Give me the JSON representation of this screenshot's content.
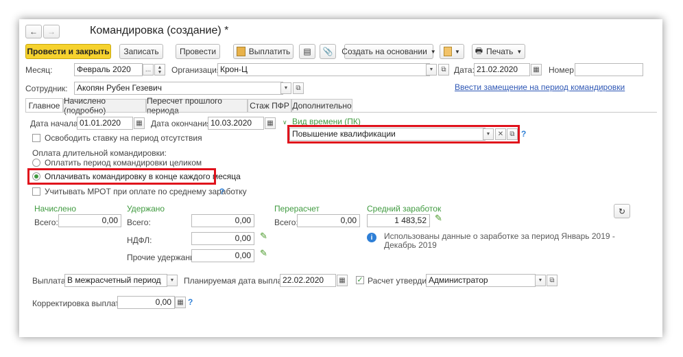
{
  "window": {
    "title": "Командировка (создание) *"
  },
  "toolbar": {
    "post_close": "Провести и закрыть",
    "save": "Записать",
    "post": "Провести",
    "pay": "Выплатить",
    "create_based": "Создать на основании",
    "print": "Печать"
  },
  "header": {
    "month_label": "Месяц:",
    "month_value": "Февраль 2020",
    "org_label": "Организация:",
    "org_value": "Крон-Ц",
    "date_label": "Дата:",
    "date_value": "21.02.2020",
    "number_label": "Номер:",
    "number_value": "",
    "employee_label": "Сотрудник:",
    "employee_value": "Акопян Рубен Гезевич",
    "replacement_link": "Ввести замещение на период командировки"
  },
  "tabs": [
    {
      "label": "Главное",
      "active": true
    },
    {
      "label": "Начислено (подробно)"
    },
    {
      "label": "Пересчет прошлого периода"
    },
    {
      "label": "Стаж ПФР"
    },
    {
      "label": "Дополнительно"
    }
  ],
  "main": {
    "start_label": "Дата начала:",
    "start_value": "01.01.2020",
    "end_label": "Дата окончания:",
    "end_value": "10.03.2020",
    "time_type_label": "Вид времени (ПК)",
    "time_type_value": "Повышение квалификации",
    "release_rate": "Освободить ставку на период отсутствия",
    "long_trip_label": "Оплата длительной командировки:",
    "radio_whole": "Оплатить период командировки целиком",
    "radio_monthly": "Оплачивать командировку в конце каждого месяца",
    "mrot": "Учитывать МРОТ при оплате по среднему заработку",
    "accrued_title": "Начислено",
    "total_label": "Всего:",
    "accrued_total": "0,00",
    "withheld_title": "Удержано",
    "withheld_total": "0,00",
    "ndfl_label": "НДФЛ:",
    "ndfl_value": "0,00",
    "other_label": "Прочие удержания:",
    "other_value": "0,00",
    "recalc_title": "Перерасчет",
    "recalc_total": "0,00",
    "avg_title": "Средний заработок",
    "avg_value": "1 483,52",
    "info_text_1": "Использованы данные о заработке за период Январь 2019 -",
    "info_text_2": "Декабрь 2019",
    "payout_label": "Выплата:",
    "payout_value": "В межрасчетный период",
    "planned_label": "Планируемая дата выплаты:",
    "planned_value": "22.02.2020",
    "approved_label": "Расчет утвердил",
    "approved_value": "Администратор",
    "correction_label": "Корректировка выплаты:",
    "correction_value": "0,00"
  },
  "colors": {
    "primary": "#f6d22e",
    "highlight": "#e0111b",
    "green": "#3f9a3f",
    "link": "#2e57b5"
  }
}
